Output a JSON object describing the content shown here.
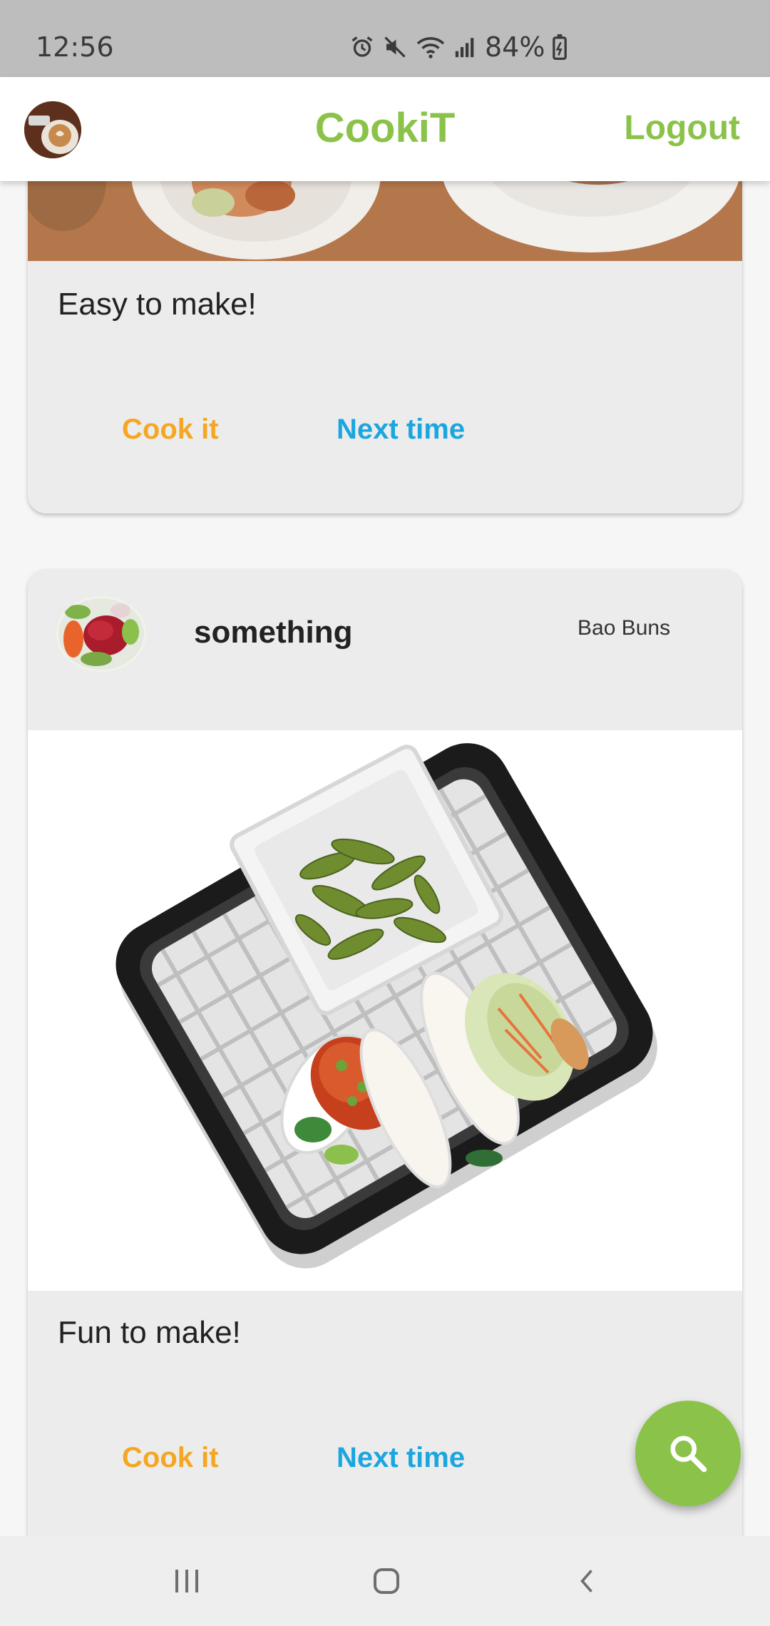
{
  "status_bar": {
    "time": "12:56",
    "battery": "84%",
    "icons": [
      "alarm-icon",
      "mute-icon",
      "wifi-icon",
      "signal-icon",
      "battery-icon"
    ]
  },
  "app_bar": {
    "title": "CookiT",
    "logout_label": "Logout"
  },
  "posts": [
    {
      "description": "Easy to make!",
      "cook_label": "Cook it",
      "next_label": "Next time"
    },
    {
      "username": "something",
      "recipe_name": "Bao Buns",
      "description": "Fun to make!",
      "cook_label": "Cook it",
      "next_label": "Next time"
    }
  ],
  "fab": {
    "icon": "search-icon"
  },
  "nav_bar": {
    "icons": [
      "recent-apps-icon",
      "home-icon",
      "back-icon"
    ]
  },
  "colors": {
    "brand": "#8bc34a",
    "cook": "#f5a623",
    "next": "#1ba6e0"
  }
}
